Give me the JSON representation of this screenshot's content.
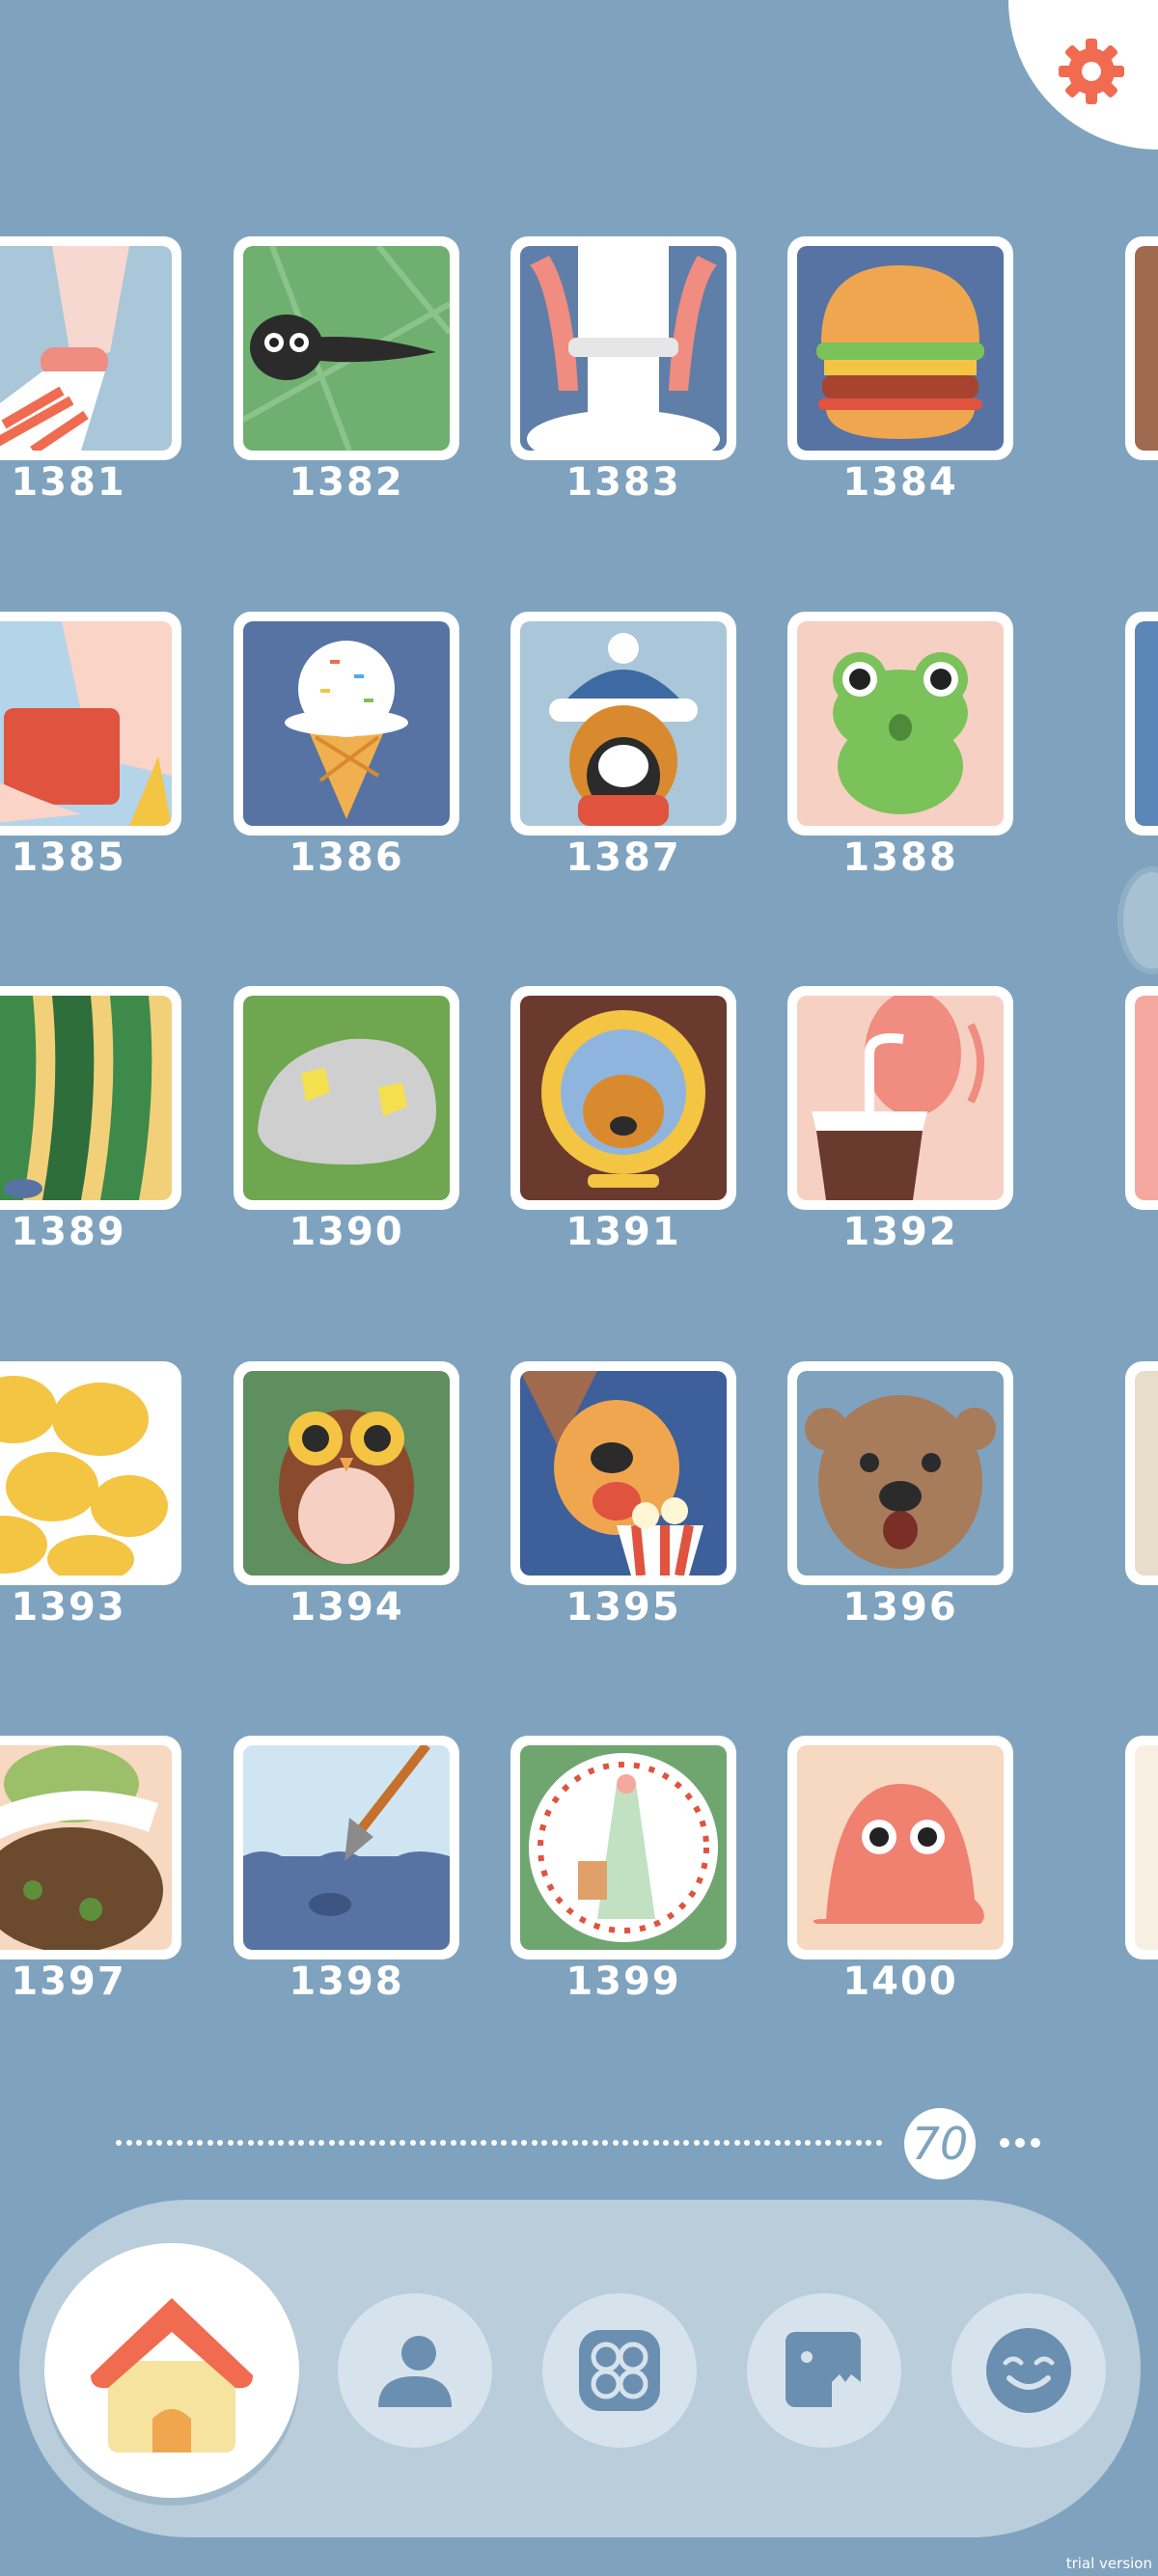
{
  "grid": {
    "labels": [
      "1381",
      "1382",
      "1383",
      "1384",
      "1385",
      "1386",
      "1387",
      "1388",
      "1389",
      "1390",
      "1391",
      "1392",
      "1393",
      "1394",
      "1395",
      "1396",
      "1397",
      "1398",
      "1399",
      "1400"
    ]
  },
  "pager": {
    "current_page": "70"
  },
  "nav": {
    "items": [
      "home-icon",
      "profile-icon",
      "collection-icon",
      "monster-icon",
      "smile-icon"
    ]
  },
  "watermark": "trial version",
  "colors": {
    "background": "#7fa3be",
    "accent": "#f06b4f",
    "nav_bar": "#b9cddb"
  }
}
